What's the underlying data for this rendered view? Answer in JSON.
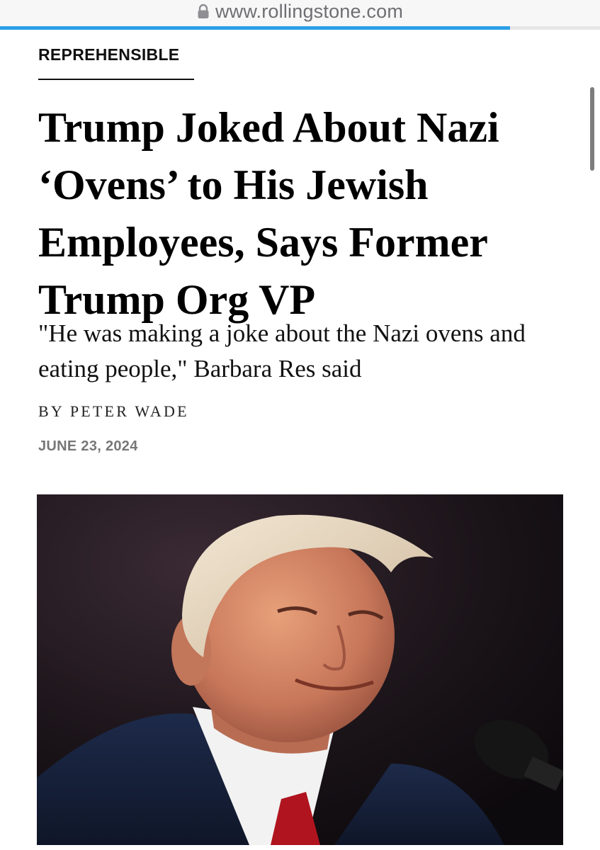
{
  "browser": {
    "url": "www.rollingstone.com",
    "lock_icon": "lock-icon",
    "load_progress": 0.85
  },
  "article": {
    "category": "REPREHENSIBLE",
    "headline": "Trump Joked About Nazi ‘Ovens’ to His Jewish Employees, Says Former Trump Org VP",
    "dek": "\"He was making a joke about the Nazi ovens and eating people,\" Barbara Res said",
    "byline": "BY PETER WADE",
    "date": "JUNE 23, 2024"
  },
  "hero_image": {
    "subject": "portrait-photo"
  },
  "colors": {
    "accent_progress": "#2d9fe6",
    "date_gray": "#777777",
    "url_gray": "#6e6e73"
  }
}
